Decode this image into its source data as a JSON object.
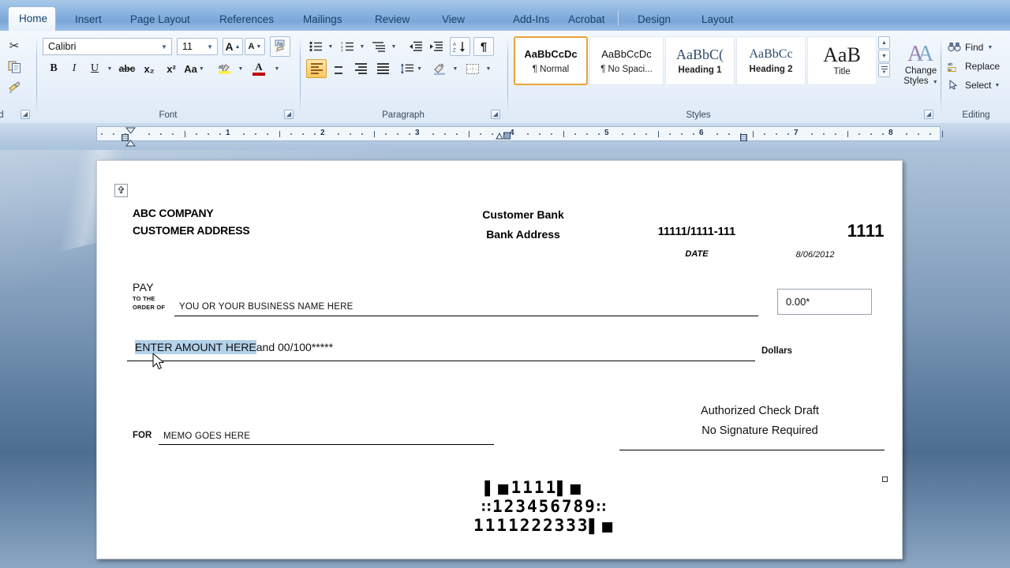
{
  "app": {
    "name": "Microsoft Word",
    "tabs": [
      {
        "label": "Home",
        "active": true
      },
      {
        "label": "Insert",
        "active": false
      },
      {
        "label": "Page Layout",
        "active": false
      },
      {
        "label": "References",
        "active": false
      },
      {
        "label": "Mailings",
        "active": false
      },
      {
        "label": "Review",
        "active": false
      },
      {
        "label": "View",
        "active": false
      },
      {
        "label": "Add-Ins",
        "active": false
      },
      {
        "label": "Acrobat",
        "active": false
      },
      {
        "label": "Design",
        "active": false
      },
      {
        "label": "Layout",
        "active": false
      }
    ]
  },
  "ribbon": {
    "clipboard": {
      "label": "ard",
      "cut_icon": "scissors-icon",
      "copy_icon": "copy-icon",
      "format_painter_icon": "paintbrush-icon"
    },
    "font": {
      "label": "Font",
      "font_name": "Calibri",
      "font_size": "11",
      "grow_font": "A",
      "shrink_font": "A",
      "clear_formatting": "Aa",
      "bold": "B",
      "italic": "I",
      "underline": "U",
      "strikethrough": "abc",
      "subscript": "x₂",
      "superscript": "x²",
      "change_case": "Aa",
      "highlight": "ab",
      "font_color": "A"
    },
    "paragraph": {
      "label": "Paragraph",
      "bullets": "bullets-icon",
      "numbering": "numbering-icon",
      "multilevel": "multilevel-list-icon",
      "decrease_indent": "decrease-indent-icon",
      "increase_indent": "increase-indent-icon",
      "sort": "sort-icon",
      "show_marks": "¶",
      "align_left": "align-left-icon",
      "align_center": "align-center-icon",
      "align_right": "align-right-icon",
      "justify": "justify-icon",
      "line_spacing": "line-spacing-icon",
      "shading": "shading-icon",
      "borders": "borders-icon"
    },
    "styles": {
      "label": "Styles",
      "gallery": [
        {
          "preview": "AaBbCcDc",
          "name": "¶ Normal",
          "selected": true
        },
        {
          "preview": "AaBbCcDc",
          "name": "¶ No Spaci...",
          "selected": false
        },
        {
          "preview": "AaBbC(",
          "name": "Heading 1",
          "selected": false
        },
        {
          "preview": "AaBbCc",
          "name": "Heading 2",
          "selected": false
        },
        {
          "preview": "AaB",
          "name": "Title",
          "selected": false
        }
      ],
      "change_styles": "Change\nStyles"
    },
    "editing": {
      "label": "Editing",
      "find": "Find",
      "replace": "Replace",
      "select": "Select"
    }
  },
  "ruler": {
    "numbers": [
      "1",
      "2",
      "3",
      "4",
      "5",
      "6",
      "7",
      "8"
    ]
  },
  "document": {
    "check": {
      "company_name": "ABC COMPANY",
      "customer_address": "CUSTOMER ADDRESS",
      "bank_name": "Customer Bank",
      "bank_address": "Bank Address",
      "routing_fraction": "11111/1111-111",
      "check_number": "1111",
      "date_label": "DATE",
      "date_value": "8/06/2012",
      "pay_label": "PAY",
      "pay_to_the": "TO THE",
      "pay_order_of": "ORDER OF",
      "payee": "YOU OR YOUR BUSINESS NAME HERE",
      "amount_numeric": "0.00*",
      "amount_words_selected": "ENTER AMOUNT HERE",
      "amount_words_rest": "and 00/100*****",
      "dollars_label": "Dollars",
      "signature_line1": "Authorized Check Draft",
      "signature_line2": "No Signature Required",
      "for_label": "FOR",
      "memo": "MEMO GOES HERE",
      "micr_check_number": "1111",
      "micr_routing": "123456789",
      "micr_account": "1111222333"
    }
  },
  "colors": {
    "selection_highlight": "#b3d2ea",
    "tab_strip": "#88b2de",
    "desktop_top": "#b4c9de",
    "desktop_mid": "#4e6e8f",
    "ribbon_bg": "#e9f1fa",
    "style_selected_border": "#e8a33d"
  }
}
